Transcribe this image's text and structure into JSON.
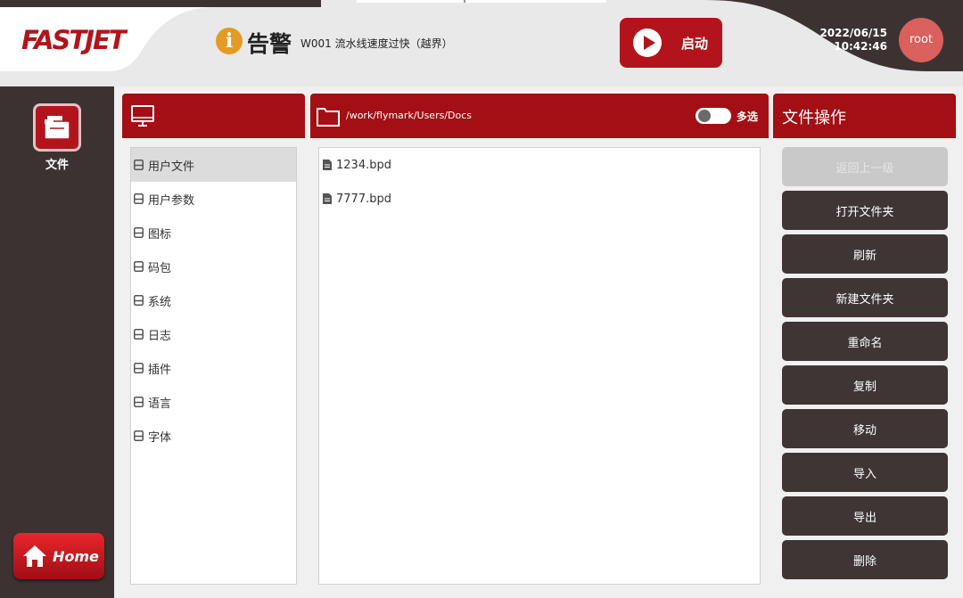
{
  "header": {
    "logo": "FASTJET",
    "alarm": {
      "icon": "info-icon",
      "icon_glyph": "i",
      "title": "告警",
      "message": "W001 流水线速度过快（越界）"
    },
    "start_button": {
      "label": "启动",
      "icon": "play-icon"
    },
    "date": "2022/06/15",
    "time": "10:42:46",
    "user": "root"
  },
  "nav": {
    "file_label": "文件",
    "home_label": "Home"
  },
  "tree": {
    "items": [
      {
        "label": "用户文件",
        "selected": true
      },
      {
        "label": "用户参数"
      },
      {
        "label": "图标"
      },
      {
        "label": "码包"
      },
      {
        "label": "系统"
      },
      {
        "label": "日志"
      },
      {
        "label": "插件"
      },
      {
        "label": "语言"
      },
      {
        "label": "字体"
      }
    ]
  },
  "files": {
    "path": "/work/flymark/Users/Docs",
    "multi_select_label": "多选",
    "items": [
      {
        "label": "1234.bpd"
      },
      {
        "label": "7777.bpd"
      }
    ]
  },
  "ops": {
    "title": "文件操作",
    "buttons": [
      {
        "label": "返回上一级",
        "disabled": true
      },
      {
        "label": "打开文件夹"
      },
      {
        "label": "刷新"
      },
      {
        "label": "新建文件夹"
      },
      {
        "label": "重命名"
      },
      {
        "label": "复制"
      },
      {
        "label": "移动"
      },
      {
        "label": "导入"
      },
      {
        "label": "导出"
      },
      {
        "label": "删除"
      }
    ]
  },
  "colors": {
    "accent": "#a30f14",
    "dark": "#3d3232",
    "panel_bg": "#f0f0f0"
  }
}
